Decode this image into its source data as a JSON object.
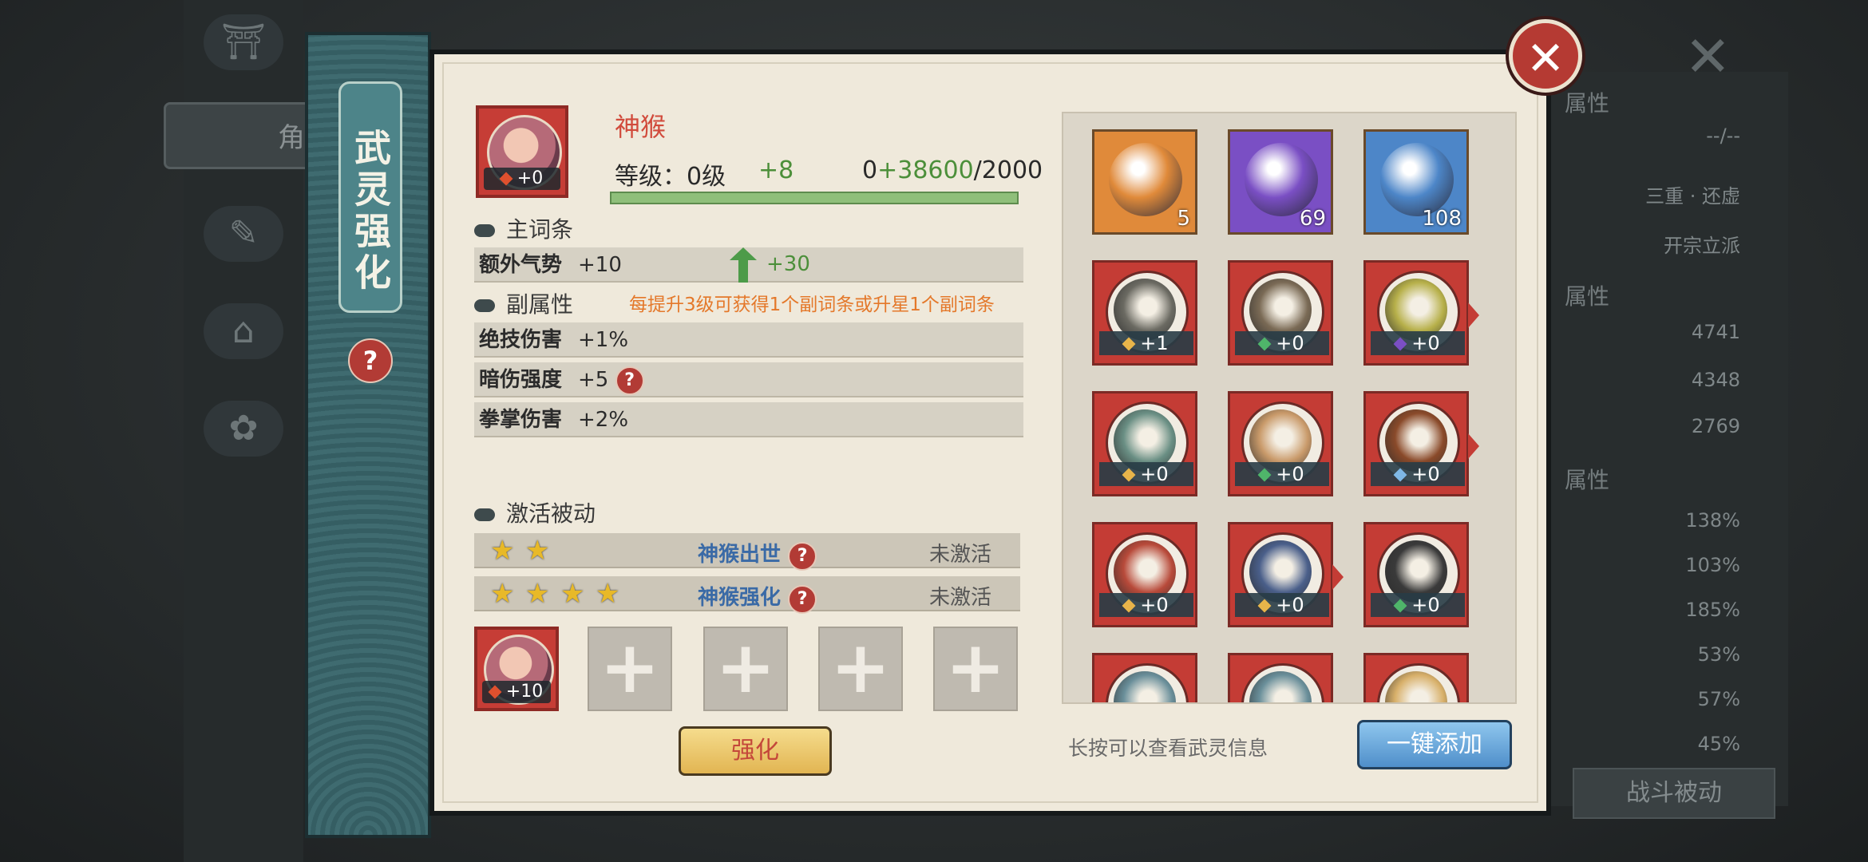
{
  "background": {
    "tab_label": "角",
    "stats": [
      "--/--",
      "三重 · 还虚",
      "开宗立派",
      "4741",
      "4348",
      "2769",
      "138%",
      "103%",
      "185%",
      "53%",
      "57%",
      "45%"
    ],
    "headers": [
      "属性",
      "属性",
      "属性"
    ],
    "battle_passive": "战斗被动"
  },
  "banner": {
    "title": "武灵强化",
    "help": "?"
  },
  "close_label": "✕",
  "hero": {
    "name": "神猴",
    "level_label": "等级：0级",
    "level_plus": "+8",
    "exp_base": "0",
    "exp_gain": "+38600",
    "exp_max": "/2000",
    "badge": "+0",
    "progress_fraction": 1.0
  },
  "main_affix": {
    "header": "主词条",
    "name": "额外气势",
    "value": "+10",
    "increase": "+30"
  },
  "sub_affix": {
    "header": "副属性",
    "note": "每提升3级可获得1个副词条或升星1个副词条",
    "rows": [
      {
        "name": "绝技伤害",
        "value": "+1%"
      },
      {
        "name": "暗伤强度",
        "value": "+5"
      },
      {
        "name": "拳掌伤害",
        "value": "+2%"
      }
    ]
  },
  "passive": {
    "header": "激活被动",
    "rows": [
      {
        "stars": 2,
        "name": "神猴出世",
        "status": "未激活"
      },
      {
        "stars": 4,
        "name": "神猴强化",
        "status": "未激活"
      }
    ]
  },
  "material_slots": {
    "filled_badge": "+10",
    "empty_count": 4
  },
  "buttons": {
    "enhance": "强化",
    "add_all": "一键添加"
  },
  "hint": "长按可以查看武灵信息",
  "inventory": {
    "materials": [
      {
        "icon": "gold-ring-icon",
        "count": "5",
        "bg": "#e08a3a"
      },
      {
        "icon": "purple-orb-icon",
        "count": "69",
        "bg": "#7a4fc4"
      },
      {
        "icon": "blue-orb-icon",
        "count": "108",
        "bg": "#4d86c8"
      }
    ],
    "spirits": [
      {
        "icon": "dragon-spirit-icon",
        "badge": "+1",
        "gem": "#e8b54a",
        "color": "#6b6a62",
        "arrow": false
      },
      {
        "icon": "dragon-spirit-icon",
        "badge": "+0",
        "gem": "#4fb56a",
        "color": "#7a6a55",
        "arrow": false
      },
      {
        "icon": "serpent-spirit-icon",
        "badge": "+0",
        "gem": "#7b4fc4",
        "color": "#b7b04a",
        "arrow": true
      },
      {
        "icon": "qilin-spirit-icon",
        "badge": "+0",
        "gem": "#e8b54a",
        "color": "#6a8f84",
        "arrow": false
      },
      {
        "icon": "lion-spirit-icon",
        "badge": "+0",
        "gem": "#4fb56a",
        "color": "#c99a6a",
        "arrow": false
      },
      {
        "icon": "boar-spirit-icon",
        "badge": "+0",
        "gem": "#7fb8e6",
        "color": "#8a4a2a",
        "arrow": true
      },
      {
        "icon": "red-dragon-spirit-icon",
        "badge": "+0",
        "gem": "#e8b54a",
        "color": "#b84a3a",
        "arrow": false
      },
      {
        "icon": "blue-dragon-spirit-icon",
        "badge": "+0",
        "gem": "#e8b54a",
        "color": "#4a5f8a",
        "arrow": true
      },
      {
        "icon": "black-beast-spirit-icon",
        "badge": "+0",
        "gem": "#4fb56a",
        "color": "#3a3a3a",
        "arrow": false
      },
      {
        "icon": "spirit-icon",
        "badge": "",
        "gem": "",
        "color": "#6a8f9a",
        "arrow": false
      },
      {
        "icon": "spirit-icon",
        "badge": "",
        "gem": "",
        "color": "#6a8f9a",
        "arrow": false
      },
      {
        "icon": "spirit-icon",
        "badge": "",
        "gem": "",
        "color": "#d8b06a",
        "arrow": false
      }
    ]
  }
}
